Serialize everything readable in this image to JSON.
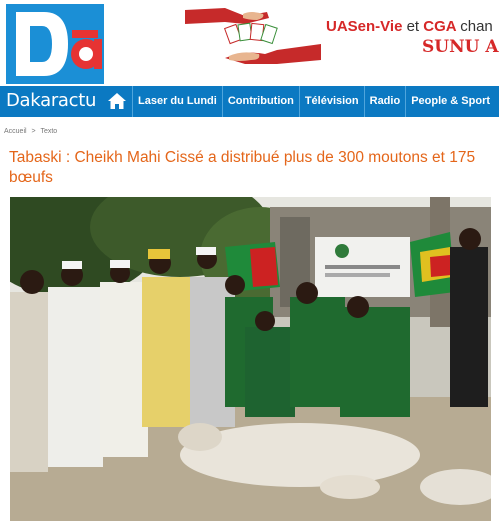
{
  "header": {
    "logo_text": "Da",
    "ad": {
      "line1_brands": "UASen-Vie",
      "line1_joiner": "et",
      "line1_brand2": "CGA",
      "line1_suffix": "chan",
      "line2": "SUNU As"
    }
  },
  "nav": {
    "brand_label": "Dakaractu",
    "items": [
      {
        "label": "Laser du Lundi"
      },
      {
        "label": "Contribution"
      },
      {
        "label": "Télévision"
      },
      {
        "label": "Radio"
      },
      {
        "label": "People & Sport"
      }
    ]
  },
  "breadcrumb": {
    "home": "Accueil",
    "separator": ">",
    "current": "Texto"
  },
  "article": {
    "title": "Tabaski : Cheikh Mahi Cissé a distribué plus de 300 moutons et 175 bœufs"
  },
  "colors": {
    "nav_blue": "#0b79c2",
    "title_orange": "#e4661a",
    "ad_red": "#d62828",
    "logo_blue": "#1b8fd6",
    "logo_red": "#e63333"
  }
}
